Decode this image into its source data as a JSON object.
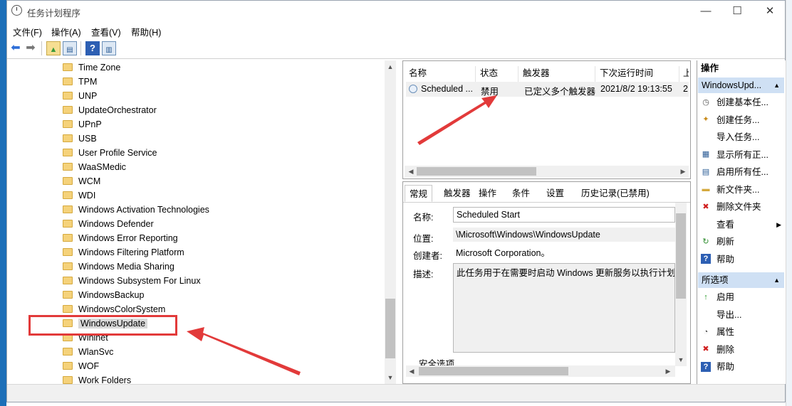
{
  "window": {
    "title": "任务计划程序",
    "minimize_icon": "minimize-icon",
    "maximize_icon": "maximize-icon",
    "close_icon": "close-icon"
  },
  "menu": [
    "文件(F)",
    "操作(A)",
    "查看(V)",
    "帮助(H)"
  ],
  "tree": {
    "items": [
      "Time Zone",
      "TPM",
      "UNP",
      "UpdateOrchestrator",
      "UPnP",
      "USB",
      "User Profile Service",
      "WaaSMedic",
      "WCM",
      "WDI",
      "Windows Activation Technologies",
      "Windows Defender",
      "Windows Error Reporting",
      "Windows Filtering Platform",
      "Windows Media Sharing",
      "Windows Subsystem For Linux",
      "WindowsBackup",
      "WindowsColorSystem",
      "WindowsUpdate",
      "Wininet",
      "WlanSvc",
      "WOF",
      "Work Folders"
    ],
    "selected": "WindowsUpdate"
  },
  "task_list": {
    "columns": [
      "名称",
      "状态",
      "触发器",
      "下次运行时间",
      "上"
    ],
    "rows": [
      {
        "name": "Scheduled ...",
        "status": "禁用",
        "trigger": "已定义多个触发器",
        "next_run": "2021/8/2 19:13:55",
        "last": "2"
      }
    ]
  },
  "details": {
    "tabs": [
      "常规",
      "触发器",
      "操作",
      "条件",
      "设置",
      "历史记录(已禁用)"
    ],
    "active_tab": "常规",
    "name_label": "名称:",
    "name_value": "Scheduled Start",
    "location_label": "位置:",
    "location_value": "\\Microsoft\\Windows\\WindowsUpdate",
    "author_label": "创建者:",
    "author_value": "Microsoft Corporation。",
    "desc_label": "描述:",
    "desc_value": "此任务用于在需要时启动 Windows 更新服务以执行计划的",
    "security_label": "安全选项"
  },
  "actions": {
    "title": "操作",
    "section1": "WindowsUpd...",
    "section1_items": [
      {
        "label": "创建基本任...",
        "icon": "clock-icon"
      },
      {
        "label": "创建任务...",
        "icon": "new-task-icon"
      },
      {
        "label": "导入任务...",
        "icon": ""
      },
      {
        "label": "显示所有正...",
        "icon": "running-tasks-icon"
      },
      {
        "label": "启用所有任...",
        "icon": "history-icon"
      },
      {
        "label": "新文件夹...",
        "icon": "folder-icon"
      },
      {
        "label": "删除文件夹",
        "icon": "delete-icon"
      },
      {
        "label": "查看",
        "icon": ""
      },
      {
        "label": "刷新",
        "icon": "refresh-icon"
      },
      {
        "label": "帮助",
        "icon": "help-icon"
      }
    ],
    "section2": "所选项",
    "section2_items": [
      {
        "label": "启用",
        "icon": "enable-icon"
      },
      {
        "label": "导出...",
        "icon": ""
      },
      {
        "label": "属性",
        "icon": "properties-icon"
      },
      {
        "label": "删除",
        "icon": "delete-icon"
      },
      {
        "label": "帮助",
        "icon": "help-icon"
      }
    ]
  },
  "colors": {
    "accent": "#cfe0f4",
    "annotation_red": "#e23a3a"
  }
}
